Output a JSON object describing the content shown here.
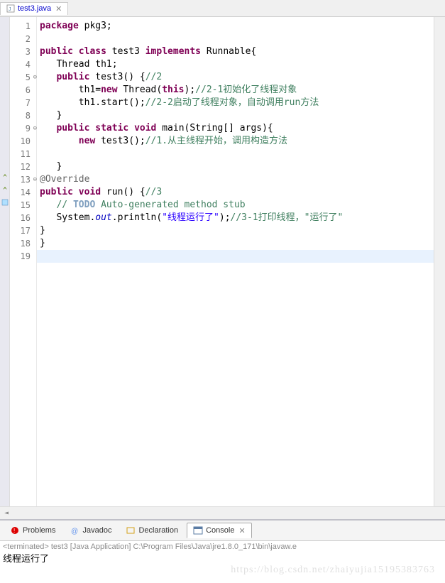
{
  "tab": {
    "filename": "test3.java"
  },
  "code": {
    "lines": [
      {
        "n": "1",
        "html": "<span class='kw'>package</span> pkg3;"
      },
      {
        "n": "2",
        "html": ""
      },
      {
        "n": "3",
        "html": "<span class='kw'>public</span> <span class='kw'>class</span> test3 <span class='kw'>implements</span> <span class='type'>Runnable</span>{"
      },
      {
        "n": "4",
        "html": "   Thread th1;"
      },
      {
        "n": "5",
        "fold": true,
        "html": "   <span class='kw'>public</span> test3() {<span class='cm-green'>//2</span>"
      },
      {
        "n": "6",
        "html": "       th1=<span class='kw'>new</span> Thread(<span class='kw'>this</span>);<span class='cm-green'>//2-1初始化了线程对象</span>"
      },
      {
        "n": "7",
        "html": "       th1.start();<span class='cm-green'>//2-2启动了线程对象，自动调用run方法</span>"
      },
      {
        "n": "8",
        "html": "   }"
      },
      {
        "n": "9",
        "fold": true,
        "html": "   <span class='kw'>public</span> <span class='kw'>static</span> <span class='kw'>void</span> main(String[] args){"
      },
      {
        "n": "10",
        "html": "       <span class='kw'>new</span> test3();<span class='cm-green'>//1.从主线程开始，调用构造方法</span>"
      },
      {
        "n": "11",
        "html": ""
      },
      {
        "n": "12",
        "html": "   }"
      },
      {
        "n": "13",
        "fold": true,
        "marker": "override",
        "html": "<span class='ann'>@Override</span>"
      },
      {
        "n": "14",
        "marker": "override",
        "html": "<span class='kw'>public</span> <span class='kw'>void</span> run() {<span class='cm-green'>//3</span>"
      },
      {
        "n": "15",
        "marker": "task",
        "html": "   <span class='cm-green'>// </span><span class='cm-todo'>TODO</span><span class='cm-green'> Auto-generated method stub</span>"
      },
      {
        "n": "16",
        "html": "   System.<span class='field-italic'>out</span>.println(<span class='str'>\"线程运行了\"</span>);<span class='cm-green'>//3-1打印线程，\"运行了\"</span>"
      },
      {
        "n": "17",
        "html": "}"
      },
      {
        "n": "18",
        "html": "}"
      },
      {
        "n": "19",
        "current": true,
        "html": ""
      }
    ]
  },
  "bottom_tabs": {
    "problems": "Problems",
    "javadoc": "Javadoc",
    "declaration": "Declaration",
    "console": "Console"
  },
  "console": {
    "header": "<terminated> test3 [Java Application] C:\\Program Files\\Java\\jre1.8.0_171\\bin\\javaw.e",
    "output": "线程运行了"
  },
  "watermark": "https://blog.csdn.net/zhaiyujia15195383763"
}
